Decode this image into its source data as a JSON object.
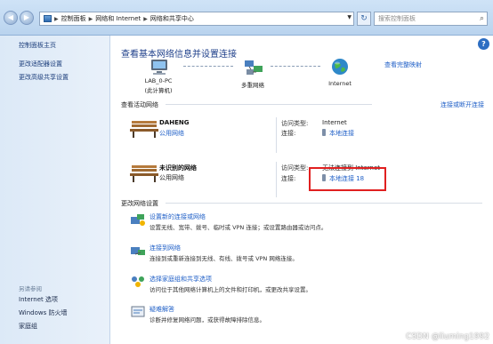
{
  "address": {
    "crumbs": [
      "控制面板",
      "网络和 Internet",
      "网络和共享中心"
    ],
    "search_placeholder": "搜索控制面板"
  },
  "sidebar": {
    "items": [
      "控制面板主页",
      "更改适配器设置",
      "更改高级共享设置"
    ],
    "see_also_label": "另请参阅",
    "see_also": [
      "Internet 选项",
      "Windows 防火墙",
      "家庭组"
    ]
  },
  "main": {
    "title": "查看基本网络信息并设置连接",
    "full_map_link": "查看完整映射",
    "map": {
      "pc_name": "LAB_0-PC",
      "pc_sub": "(此计算机)",
      "middle": "多重网络",
      "internet": "Internet"
    },
    "active_label": "查看活动网络",
    "connect_link": "连接或断开连接",
    "networks": [
      {
        "name": "DAHENG",
        "type": "公用网络",
        "access_label": "访问类型:",
        "access_value": "Internet",
        "conn_label": "连接:",
        "conn_value": "本地连接"
      },
      {
        "name": "未识别的网络",
        "type": "公用网络",
        "access_label": "访问类型:",
        "access_value": "无法连接到 Internet",
        "conn_label": "连接:",
        "conn_value": "本地连接 18"
      }
    ],
    "change_label": "更改网络设置",
    "tasks": [
      {
        "title": "设置新的连接或网络",
        "desc": "设置无线、宽带、拨号、临时或 VPN 连接；或设置路由器或访问点。"
      },
      {
        "title": "连接到网络",
        "desc": "连接到或重新连接到无线、有线、拨号或 VPN 网络连接。"
      },
      {
        "title": "选择家庭组和共享选项",
        "desc": "访问位于其他网络计算机上的文件和打印机，或更改共享设置。"
      },
      {
        "title": "疑难解答",
        "desc": "诊断并修复网络问题，或获得故障排除信息。"
      }
    ]
  },
  "watermark": "CSDN @liuming1992",
  "colors": {
    "link": "#1f5fc7",
    "title": "#1e3f8a",
    "highlight": "#e02020",
    "sidebar_bg": "#dce9f7"
  }
}
